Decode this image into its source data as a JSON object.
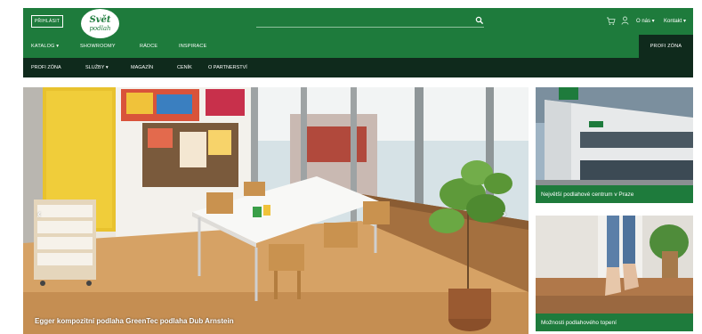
{
  "header": {
    "login_label": "PŘIHLÁSIT",
    "logo_line1": "Svět",
    "logo_line2": "podlah",
    "search_placeholder": "",
    "about_label": "O nás ▾",
    "contact_label": "Kontakt ▾"
  },
  "catnav": {
    "items": [
      {
        "label": "KATALOG ▾"
      },
      {
        "label": "SHOWROOMY"
      },
      {
        "label": "RÁDCE"
      },
      {
        "label": "INSPIRACE"
      }
    ],
    "profi_label": "PROFI ZÓNA"
  },
  "subnav": {
    "items": [
      {
        "label": "PROFI ZÓNA"
      },
      {
        "label": "SLUŽBY ▾"
      },
      {
        "label": "MAGAZÍN"
      },
      {
        "label": "CENÍK"
      },
      {
        "label": "O PARTNERSTVÍ"
      }
    ]
  },
  "hero": {
    "caption": "Egger kompozitní podlaha GreenTec podlaha Dub Arnstein",
    "prev_arrow": "‹",
    "next_arrow": "›"
  },
  "promos": [
    {
      "label": "Největší podlahové centrum v Praze"
    },
    {
      "label": "Možnosti podlahového topení"
    }
  ],
  "colors": {
    "brand_green": "#1e7b3c",
    "dark_green": "#0f2a1c"
  }
}
